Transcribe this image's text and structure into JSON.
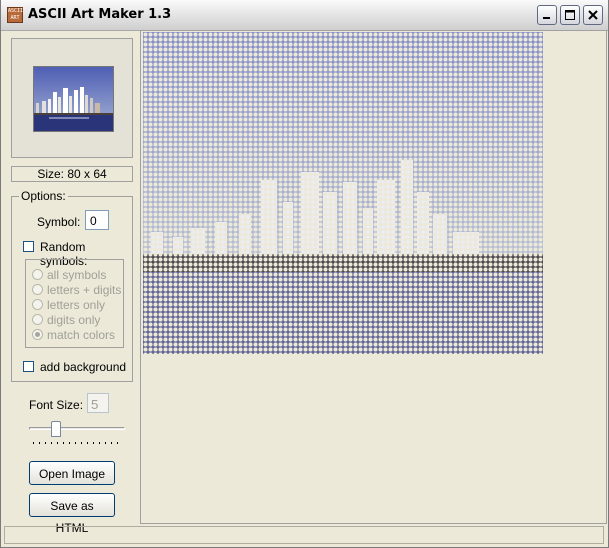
{
  "window": {
    "title": "ASCII Art Maker 1.3",
    "icon": "ascii-art-app-icon"
  },
  "titlebar_buttons": [
    "minimize-icon",
    "maximize-icon",
    "close-icon"
  ],
  "preview": {
    "size_text": "Size: 80 x 64"
  },
  "options": {
    "legend": "Options:",
    "symbol_label": "Symbol:",
    "symbol_value": "0",
    "random_symbols_label": "Random symbols:",
    "random_symbols_checked": false,
    "radios": [
      {
        "label": "all symbols",
        "selected": false
      },
      {
        "label": "letters + digits",
        "selected": false
      },
      {
        "label": "letters only",
        "selected": false
      },
      {
        "label": "digits only",
        "selected": false
      },
      {
        "label": "match colors",
        "selected": true
      }
    ],
    "add_background_label": "add background",
    "add_background_checked": false
  },
  "font_size": {
    "label": "Font Size:",
    "value": "5"
  },
  "buttons": {
    "open_image": "Open Image",
    "save_html": "Save as HTML"
  },
  "colors": {
    "sky_top": "#7b85c7",
    "sky_bottom": "#b6bfd4",
    "building": "#ececf2",
    "water": "#555a90",
    "shore": "#3c3c44"
  },
  "art": {
    "columns": 80,
    "rows": 64,
    "symbol": "0"
  }
}
